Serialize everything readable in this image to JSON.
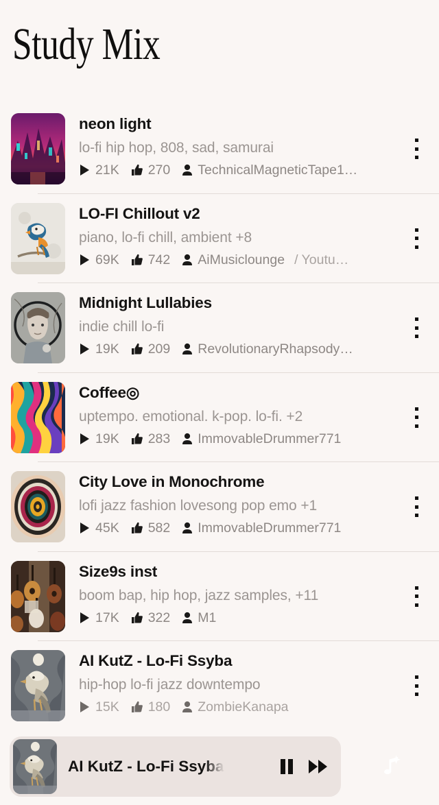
{
  "header": {
    "title": "Study Mix"
  },
  "theme": {
    "background": "#faf6f4",
    "text_primary": "#141312",
    "text_muted": "#9b9592",
    "separator": "#e2dbd7",
    "player_background": "#ebe3e0",
    "fab_gradient_start": "#f8784f",
    "fab_gradient_end": "#8338bd"
  },
  "tracks": [
    {
      "title": "neon light",
      "tags": "lo-fi hip hop, 808, sad, samurai",
      "plays": "21K",
      "likes": "270",
      "uploader": "TechnicalMagneticTape1…",
      "source": "",
      "art": "neon-city"
    },
    {
      "title": "LO-FI Chillout v2",
      "tags": "piano, lo-fi chill, ambient +8",
      "plays": "69K",
      "likes": "742",
      "uploader": "AiMusiclounge",
      "source": "/ Youtu…",
      "art": "bird-branch"
    },
    {
      "title": "Midnight Lullabies",
      "tags": "indie chill lo-fi",
      "plays": "19K",
      "likes": "209",
      "uploader": "RevolutionaryRhapsody…",
      "source": "",
      "art": "portrait-circle"
    },
    {
      "title": "Coffee◎",
      "tags": "uptempo. emotional. k-pop. lo-fi. +2",
      "plays": "19K",
      "likes": "283",
      "uploader": "ImmovableDrummer771",
      "source": "",
      "art": "psychedelic-swirl"
    },
    {
      "title": "City Love in Monochrome",
      "tags": "lofi jazz fashion lovesong pop emo +1",
      "plays": "45K",
      "likes": "582",
      "uploader": "ImmovableDrummer771",
      "source": "",
      "art": "concentric-rings"
    },
    {
      "title": "Size9s inst",
      "tags": "boom bap, hip hop, jazz samples, +11",
      "plays": "17K",
      "likes": "322",
      "uploader": "M1",
      "source": "",
      "art": "guitars-photo"
    },
    {
      "title": "AI KutZ - Lo-Fi Ssyba",
      "tags": "hip-hop lo-fi jazz downtempo",
      "plays": "15K",
      "likes": "180",
      "uploader": "ZombieKanapa",
      "source": "",
      "art": "bird-woodcut"
    }
  ],
  "player": {
    "now_playing_title": "AI KutZ - Lo-Fi Ssyba",
    "pause_label": "Pause",
    "next_label": "Next",
    "art": "bird-woodcut"
  },
  "fab": {
    "label": "Create music"
  },
  "icons": {
    "play": "play-icon",
    "like": "thumbs-up-icon",
    "user": "person-icon",
    "menu": "kebab-menu-icon",
    "pause": "pause-icon",
    "next": "fast-forward-icon",
    "fab": "music-note-sparkle-icon"
  }
}
